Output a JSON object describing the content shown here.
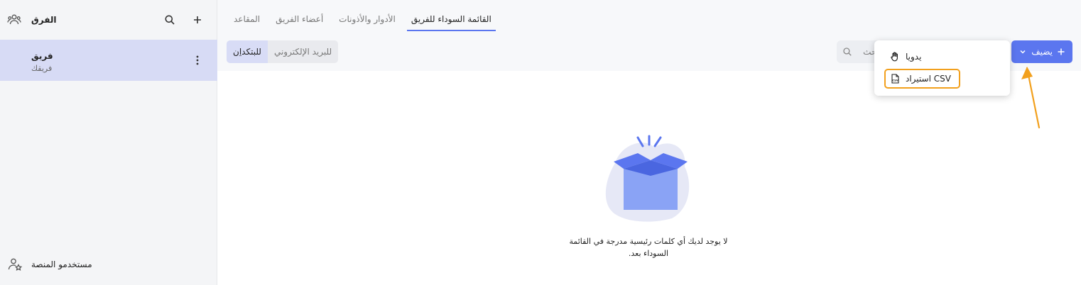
{
  "sidebar": {
    "title": "الفرق",
    "team": {
      "name": "فريق",
      "subtitle": "فريقك"
    },
    "footer_label": "مستخدمو المنصة"
  },
  "tabs": [
    {
      "label": "القائمة السوداء للفريق",
      "active": true
    },
    {
      "label": "الأدوار والأذونات",
      "active": false
    },
    {
      "label": "أعضاء الفريق",
      "active": false
    },
    {
      "label": "المقاعد",
      "active": false
    }
  ],
  "segment": [
    {
      "label": "للبتكداِن",
      "active": true
    },
    {
      "label": "للبريد الإلكتروني",
      "active": false
    }
  ],
  "search": {
    "placeholder": "بحث"
  },
  "add_button": {
    "label": "يضيف"
  },
  "dropdown": [
    {
      "label": "يدويا",
      "icon": "hand-icon"
    },
    {
      "label": "استيراد CSV",
      "icon": "csv-file-icon"
    }
  ],
  "empty_state": {
    "message": "لا يوجد لديك أي كلمات رئيسية مدرجة في القائمة السوداء بعد."
  },
  "colors": {
    "accent": "#5b76ef",
    "highlight": "#f2a01d",
    "selected_bg": "#d7dbf5"
  }
}
